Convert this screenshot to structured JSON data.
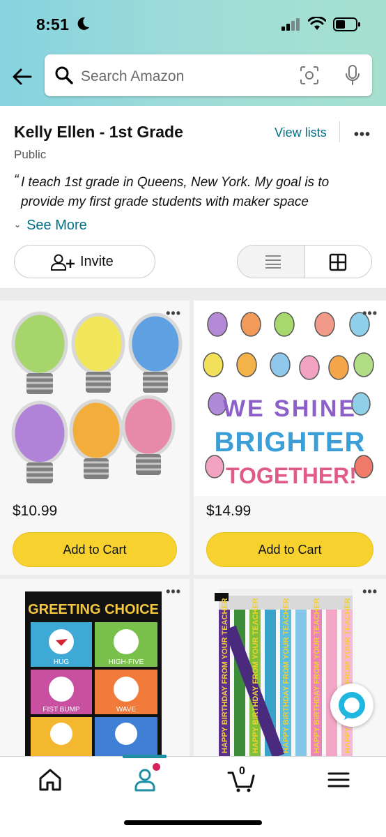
{
  "status_bar": {
    "time": "8:51"
  },
  "search": {
    "placeholder": "Search Amazon"
  },
  "list": {
    "title": "Kelly Ellen - 1st Grade",
    "visibility": "Public",
    "view_lists": "View lists",
    "description_quote": "“",
    "description": "I teach 1st grade in Queens, New York. My goal is to provide my first grade students with maker space",
    "see_more": "See More",
    "invite": "Invite"
  },
  "products": [
    {
      "price": "$10.99",
      "cta": "Add to Cart",
      "image": "colorful lightbulb cutouts"
    },
    {
      "price": "$14.99",
      "cta": "Add to Cart",
      "image": "we shine brighter together poster"
    },
    {
      "image": "greeting choice poster",
      "poster_title": "GREETING CHOICE",
      "tiles": [
        "HUG",
        "HIGH-FIVE",
        "FIST BUMP",
        "WAVE"
      ]
    },
    {
      "image": "happy birthday pencils",
      "pencil_text": "HAPPY BIRTHDAY FROM YOUR TEACHER"
    }
  ],
  "poster_text": {
    "line1": "WE SHINE",
    "line2": "BRIGHTER",
    "line3": "TOGETHER!"
  },
  "nav": {
    "cart_count": "0",
    "items": [
      "home-icon",
      "account-icon",
      "cart-icon",
      "menu-icon"
    ]
  },
  "colors": {
    "accent": "#007185",
    "add_to_cart": "#f7d22f",
    "header_start": "#86d3df",
    "header_end": "#a6e1cf",
    "badge": "#d6225b"
  }
}
